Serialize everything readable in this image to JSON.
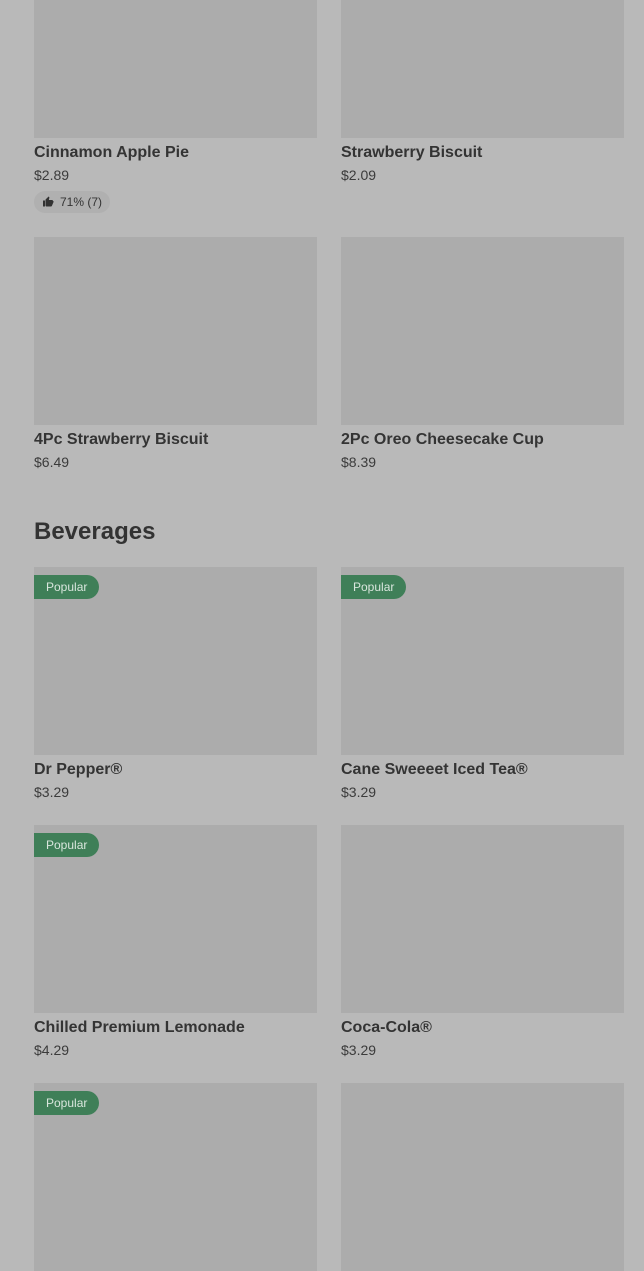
{
  "top_items": [
    {
      "name": "Cinnamon Apple Pie",
      "price": "$2.89",
      "rating": "71% (7)"
    },
    {
      "name": "Strawberry Biscuit",
      "price": "$2.09"
    },
    {
      "name": "4Pc Strawberry Biscuit",
      "price": "$6.49"
    },
    {
      "name": "2Pc Oreo Cheesecake Cup",
      "price": "$8.39"
    }
  ],
  "beverages": {
    "title": "Beverages",
    "items": [
      {
        "name": "Dr Pepper®",
        "price": "$3.29",
        "badge": "Popular"
      },
      {
        "name": "Cane Sweeeet Iced Tea®",
        "price": "$3.29",
        "badge": "Popular"
      },
      {
        "name": "Chilled Premium Lemonade",
        "price": "$4.29",
        "badge": "Popular"
      },
      {
        "name": "Coca-Cola®",
        "price": "$3.29"
      },
      {
        "badge": "Popular"
      }
    ]
  },
  "icons": {
    "rating": "thumbs-up-icon"
  },
  "colors": {
    "badge": "#3f7f58",
    "background": "#b9b9b9"
  }
}
